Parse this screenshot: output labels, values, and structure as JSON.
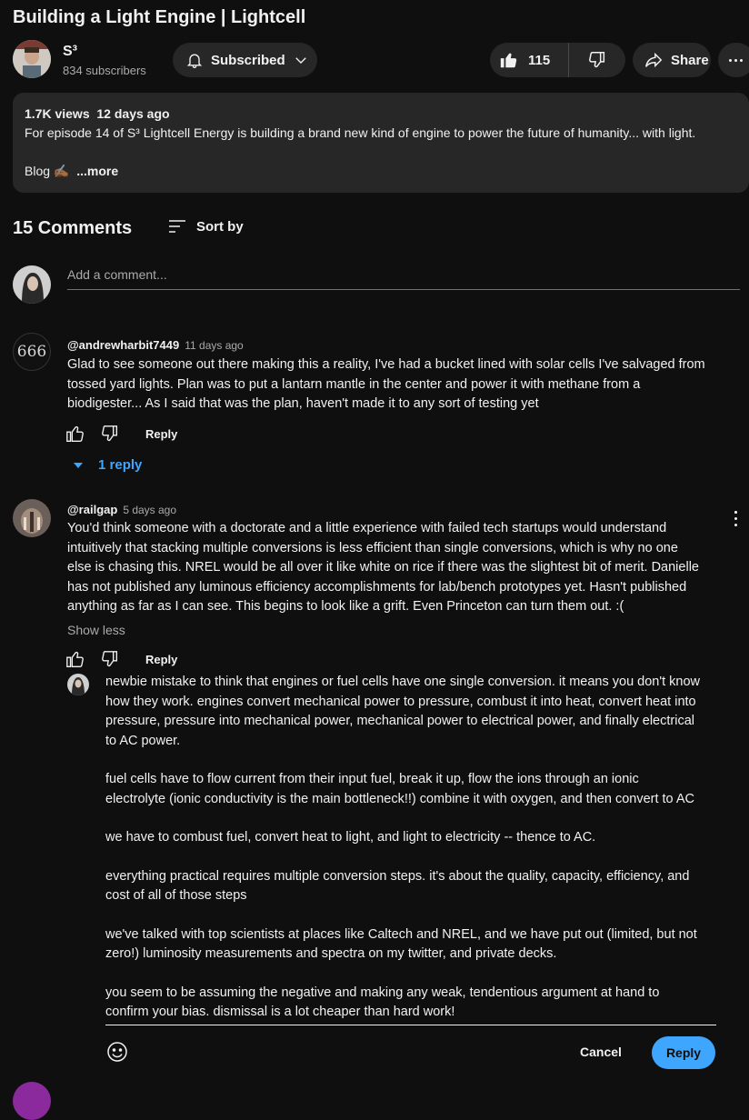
{
  "video": {
    "title": "Building a Light Engine | Lightcell"
  },
  "channel": {
    "name": "S³",
    "subscribers": "834 subscribers",
    "subscribe_label": "Subscribed",
    "likes": "115",
    "share_label": "Share"
  },
  "description": {
    "views": "1.7K views",
    "age": "12 days ago",
    "text": "For episode 14 of S³ Lightcell Energy is building a brand new kind of engine to power the future of humanity... with light.",
    "blog": "Blog ✍🏾",
    "more": "...more"
  },
  "comments": {
    "count_label": "15 Comments",
    "sort_label": "Sort by",
    "add_placeholder": "Add a comment...",
    "items": [
      {
        "handle": "@andrewharbit7449",
        "time": "11 days ago",
        "avatar_text": "666",
        "lines": [
          "Glad to see someone out there making this a reality, I've had a bucket lined with solar cells I've salvaged from",
          "tossed yard lights. Plan was to put a lantarn mantle in the center and power it with methane from a",
          "biodigester... As I said that was the plan, haven't made it to any sort of testing yet"
        ],
        "reply_label": "Reply",
        "replies_link": "1 reply"
      },
      {
        "handle": "@railgap",
        "time": "5 days ago",
        "lines": [
          "You'd think someone with a doctorate and a little experience with failed tech startups would understand",
          "intuitively that stacking multiple conversions is less efficient than single conversions, which is why no one",
          "else is chasing this.  NREL would be all over it like white on rice if there was the slightest bit of merit. Danielle",
          "has not published any luminous efficiency accomplishments for lab/bench prototypes yet. Hasn't published",
          "anything as far as I can see. This begins to look like a grift. Even Princeton can turn them out. :("
        ],
        "show_less": "Show less",
        "reply_label": "Reply"
      }
    ]
  },
  "reply_draft": {
    "paragraphs": [
      "newbie mistake to think that engines or fuel cells have one single conversion. it means you don't know\nhow they work. engines convert mechanical power to pressure, combust it into heat, convert heat into\npressure, pressure into mechanical power, mechanical power to electrical power, and finally electrical\nto AC power.",
      "fuel cells have to flow current from their input fuel, break it up, flow the ions through an ionic\nelectrolyte (ionic conductivity is the main bottleneck!!) combine it with oxygen, and then convert to AC",
      "we have to combust fuel, convert heat to light, and light to electricity -- thence to AC.",
      "everything practical requires multiple conversion steps. it's about the quality, capacity, efficiency, and\ncost of all of those steps",
      "we've talked with top scientists at places like Caltech and NREL, and we have put out (limited, but not\nzero!) luminosity measurements and spectra on my twitter, and private decks.",
      "you seem to be assuming the negative and making any weak, tendentious argument at hand to\nconfirm your bias. dismissal is a lot cheaper than hard work!"
    ],
    "cancel_label": "Cancel",
    "reply_label": "Reply"
  },
  "colors": {
    "background": "#0f0f0f",
    "surface": "#272727",
    "accent": "#3ea6ff",
    "secondary_text": "#aaaaaa"
  },
  "icons": [
    "bell-icon",
    "chevron-down-icon",
    "thumbs-up-icon",
    "thumbs-down-icon",
    "share-icon",
    "more-horiz-icon",
    "sort-icon",
    "emoji-icon",
    "more-vert-icon"
  ]
}
